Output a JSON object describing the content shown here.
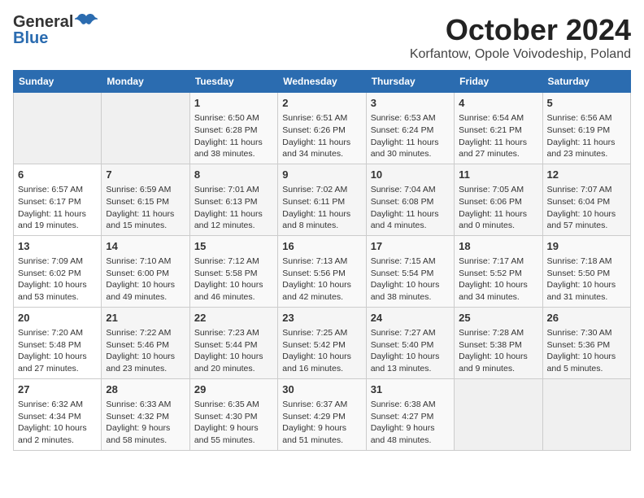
{
  "header": {
    "logo_general": "General",
    "logo_blue": "Blue",
    "month_title": "October 2024",
    "location": "Korfantow, Opole Voivodeship, Poland"
  },
  "days_of_week": [
    "Sunday",
    "Monday",
    "Tuesday",
    "Wednesday",
    "Thursday",
    "Friday",
    "Saturday"
  ],
  "weeks": [
    [
      {
        "num": "",
        "sunrise": "",
        "sunset": "",
        "daylight": ""
      },
      {
        "num": "",
        "sunrise": "",
        "sunset": "",
        "daylight": ""
      },
      {
        "num": "1",
        "sunrise": "Sunrise: 6:50 AM",
        "sunset": "Sunset: 6:28 PM",
        "daylight": "Daylight: 11 hours and 38 minutes."
      },
      {
        "num": "2",
        "sunrise": "Sunrise: 6:51 AM",
        "sunset": "Sunset: 6:26 PM",
        "daylight": "Daylight: 11 hours and 34 minutes."
      },
      {
        "num": "3",
        "sunrise": "Sunrise: 6:53 AM",
        "sunset": "Sunset: 6:24 PM",
        "daylight": "Daylight: 11 hours and 30 minutes."
      },
      {
        "num": "4",
        "sunrise": "Sunrise: 6:54 AM",
        "sunset": "Sunset: 6:21 PM",
        "daylight": "Daylight: 11 hours and 27 minutes."
      },
      {
        "num": "5",
        "sunrise": "Sunrise: 6:56 AM",
        "sunset": "Sunset: 6:19 PM",
        "daylight": "Daylight: 11 hours and 23 minutes."
      }
    ],
    [
      {
        "num": "6",
        "sunrise": "Sunrise: 6:57 AM",
        "sunset": "Sunset: 6:17 PM",
        "daylight": "Daylight: 11 hours and 19 minutes."
      },
      {
        "num": "7",
        "sunrise": "Sunrise: 6:59 AM",
        "sunset": "Sunset: 6:15 PM",
        "daylight": "Daylight: 11 hours and 15 minutes."
      },
      {
        "num": "8",
        "sunrise": "Sunrise: 7:01 AM",
        "sunset": "Sunset: 6:13 PM",
        "daylight": "Daylight: 11 hours and 12 minutes."
      },
      {
        "num": "9",
        "sunrise": "Sunrise: 7:02 AM",
        "sunset": "Sunset: 6:11 PM",
        "daylight": "Daylight: 11 hours and 8 minutes."
      },
      {
        "num": "10",
        "sunrise": "Sunrise: 7:04 AM",
        "sunset": "Sunset: 6:08 PM",
        "daylight": "Daylight: 11 hours and 4 minutes."
      },
      {
        "num": "11",
        "sunrise": "Sunrise: 7:05 AM",
        "sunset": "Sunset: 6:06 PM",
        "daylight": "Daylight: 11 hours and 0 minutes."
      },
      {
        "num": "12",
        "sunrise": "Sunrise: 7:07 AM",
        "sunset": "Sunset: 6:04 PM",
        "daylight": "Daylight: 10 hours and 57 minutes."
      }
    ],
    [
      {
        "num": "13",
        "sunrise": "Sunrise: 7:09 AM",
        "sunset": "Sunset: 6:02 PM",
        "daylight": "Daylight: 10 hours and 53 minutes."
      },
      {
        "num": "14",
        "sunrise": "Sunrise: 7:10 AM",
        "sunset": "Sunset: 6:00 PM",
        "daylight": "Daylight: 10 hours and 49 minutes."
      },
      {
        "num": "15",
        "sunrise": "Sunrise: 7:12 AM",
        "sunset": "Sunset: 5:58 PM",
        "daylight": "Daylight: 10 hours and 46 minutes."
      },
      {
        "num": "16",
        "sunrise": "Sunrise: 7:13 AM",
        "sunset": "Sunset: 5:56 PM",
        "daylight": "Daylight: 10 hours and 42 minutes."
      },
      {
        "num": "17",
        "sunrise": "Sunrise: 7:15 AM",
        "sunset": "Sunset: 5:54 PM",
        "daylight": "Daylight: 10 hours and 38 minutes."
      },
      {
        "num": "18",
        "sunrise": "Sunrise: 7:17 AM",
        "sunset": "Sunset: 5:52 PM",
        "daylight": "Daylight: 10 hours and 34 minutes."
      },
      {
        "num": "19",
        "sunrise": "Sunrise: 7:18 AM",
        "sunset": "Sunset: 5:50 PM",
        "daylight": "Daylight: 10 hours and 31 minutes."
      }
    ],
    [
      {
        "num": "20",
        "sunrise": "Sunrise: 7:20 AM",
        "sunset": "Sunset: 5:48 PM",
        "daylight": "Daylight: 10 hours and 27 minutes."
      },
      {
        "num": "21",
        "sunrise": "Sunrise: 7:22 AM",
        "sunset": "Sunset: 5:46 PM",
        "daylight": "Daylight: 10 hours and 23 minutes."
      },
      {
        "num": "22",
        "sunrise": "Sunrise: 7:23 AM",
        "sunset": "Sunset: 5:44 PM",
        "daylight": "Daylight: 10 hours and 20 minutes."
      },
      {
        "num": "23",
        "sunrise": "Sunrise: 7:25 AM",
        "sunset": "Sunset: 5:42 PM",
        "daylight": "Daylight: 10 hours and 16 minutes."
      },
      {
        "num": "24",
        "sunrise": "Sunrise: 7:27 AM",
        "sunset": "Sunset: 5:40 PM",
        "daylight": "Daylight: 10 hours and 13 minutes."
      },
      {
        "num": "25",
        "sunrise": "Sunrise: 7:28 AM",
        "sunset": "Sunset: 5:38 PM",
        "daylight": "Daylight: 10 hours and 9 minutes."
      },
      {
        "num": "26",
        "sunrise": "Sunrise: 7:30 AM",
        "sunset": "Sunset: 5:36 PM",
        "daylight": "Daylight: 10 hours and 5 minutes."
      }
    ],
    [
      {
        "num": "27",
        "sunrise": "Sunrise: 6:32 AM",
        "sunset": "Sunset: 4:34 PM",
        "daylight": "Daylight: 10 hours and 2 minutes."
      },
      {
        "num": "28",
        "sunrise": "Sunrise: 6:33 AM",
        "sunset": "Sunset: 4:32 PM",
        "daylight": "Daylight: 9 hours and 58 minutes."
      },
      {
        "num": "29",
        "sunrise": "Sunrise: 6:35 AM",
        "sunset": "Sunset: 4:30 PM",
        "daylight": "Daylight: 9 hours and 55 minutes."
      },
      {
        "num": "30",
        "sunrise": "Sunrise: 6:37 AM",
        "sunset": "Sunset: 4:29 PM",
        "daylight": "Daylight: 9 hours and 51 minutes."
      },
      {
        "num": "31",
        "sunrise": "Sunrise: 6:38 AM",
        "sunset": "Sunset: 4:27 PM",
        "daylight": "Daylight: 9 hours and 48 minutes."
      },
      {
        "num": "",
        "sunrise": "",
        "sunset": "",
        "daylight": ""
      },
      {
        "num": "",
        "sunrise": "",
        "sunset": "",
        "daylight": ""
      }
    ]
  ]
}
